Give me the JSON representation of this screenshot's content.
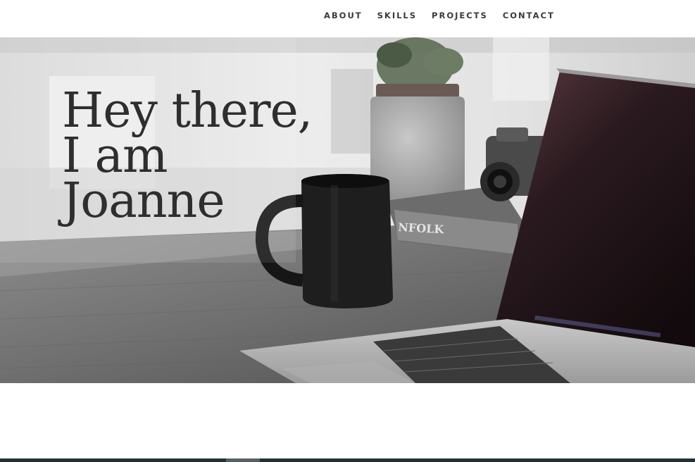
{
  "nav": {
    "items": [
      {
        "label": "ABOUT"
      },
      {
        "label": "SKILLS"
      },
      {
        "label": "PROJECTS"
      },
      {
        "label": "CONTACT"
      }
    ]
  },
  "hero": {
    "title_lines": [
      "Hey there,",
      "I am",
      "Joanne"
    ],
    "image_icon": "desk-photo-laptop-mug-camera"
  },
  "colors": {
    "nav_text": "#3a3a3a",
    "hero_text": "#2e2e2e",
    "footer_bar": "#223038"
  }
}
